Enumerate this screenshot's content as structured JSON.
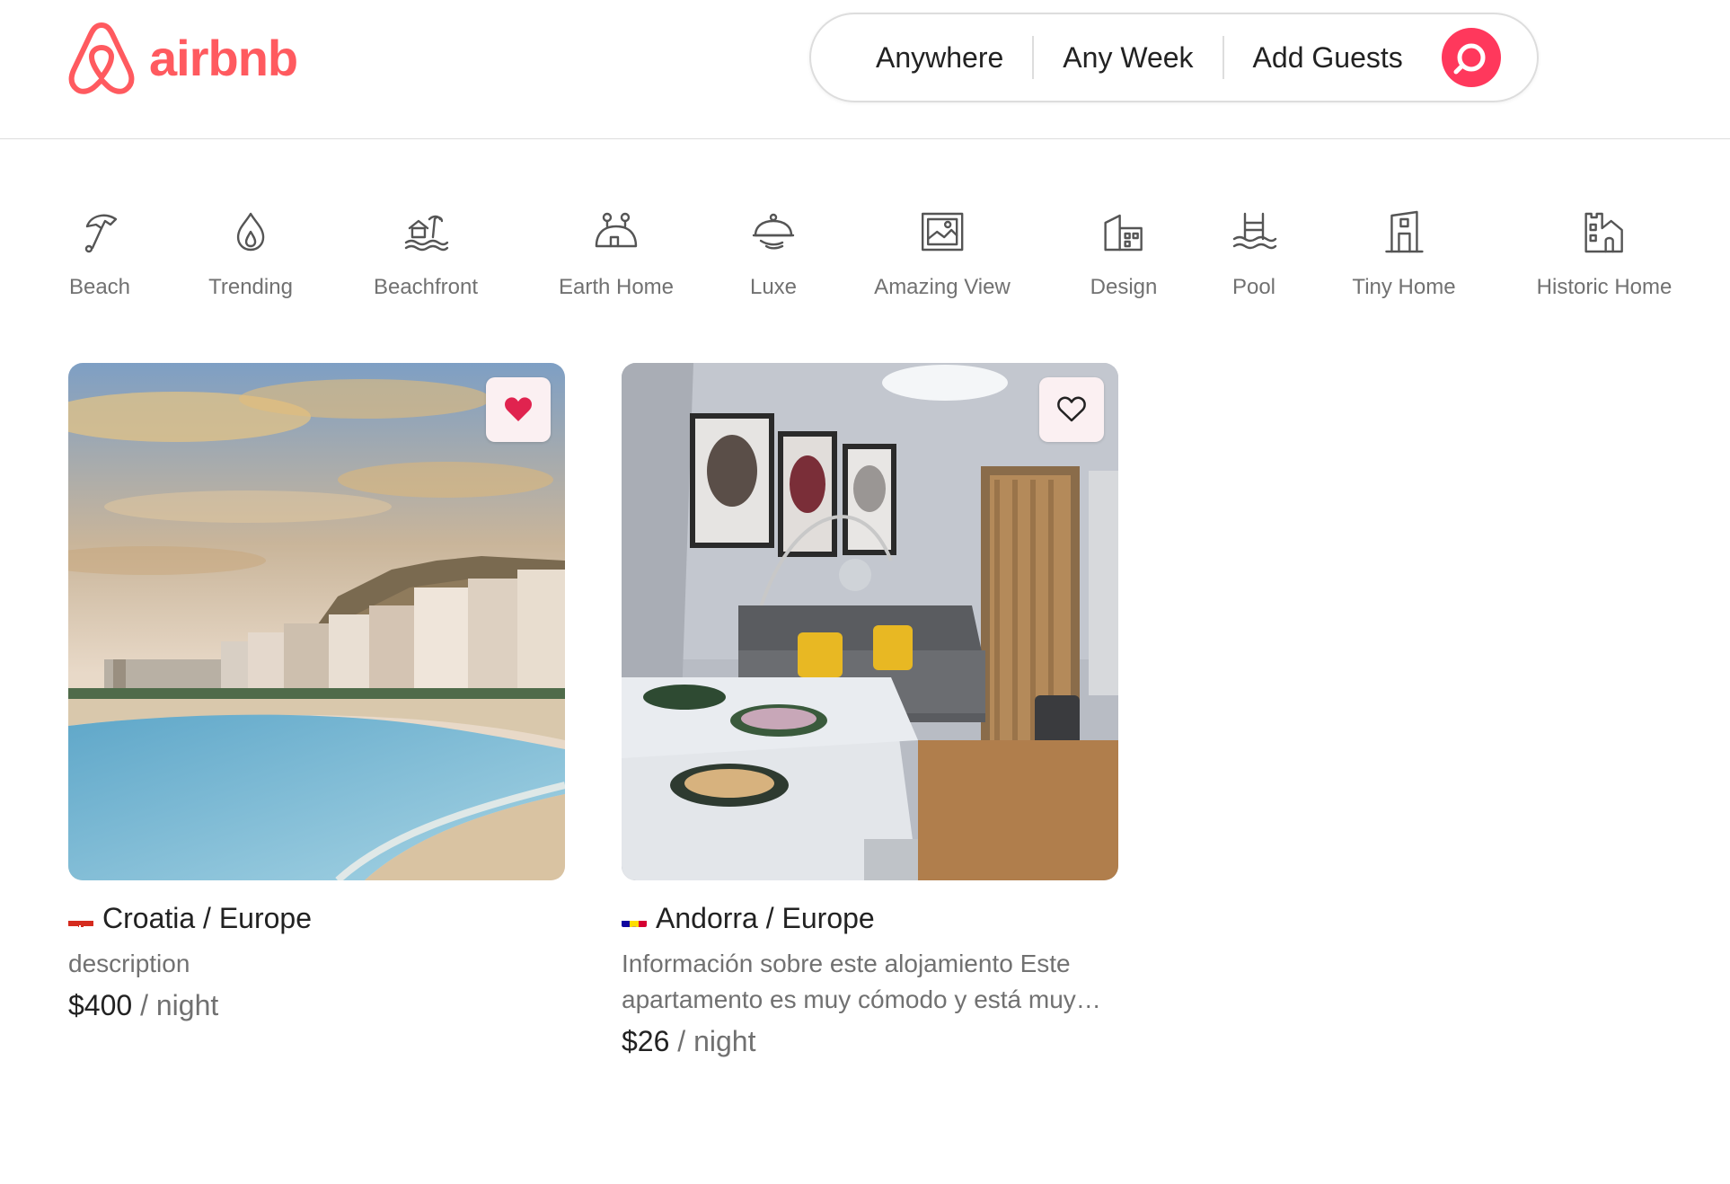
{
  "header": {
    "logo_text": "airbnb",
    "brand_color": "#ff5a5f",
    "search": {
      "where": "Anywhere",
      "when": "Any Week",
      "who": "Add Guests",
      "button_color": "#ff385c"
    }
  },
  "categories": [
    {
      "label": "Beach",
      "icon": "umbrella-icon"
    },
    {
      "label": "Trending",
      "icon": "flame-icon"
    },
    {
      "label": "Beachfront",
      "icon": "beachfront-icon"
    },
    {
      "label": "Earth Home",
      "icon": "earth-home-icon"
    },
    {
      "label": "Luxe",
      "icon": "cloche-icon"
    },
    {
      "label": "Amazing View",
      "icon": "view-icon"
    },
    {
      "label": "Design",
      "icon": "design-icon"
    },
    {
      "label": "Pool",
      "icon": "pool-icon"
    },
    {
      "label": "Tiny Home",
      "icon": "tiny-home-icon"
    },
    {
      "label": "Historic Home",
      "icon": "castle-icon"
    }
  ],
  "listings": [
    {
      "flag": "croatia-flag-icon",
      "location": "Croatia / Europe",
      "description": "description",
      "price": "$400",
      "price_unit": "/ night",
      "favorited": true
    },
    {
      "flag": "andorra-flag-icon",
      "location": "Andorra / Europe",
      "description": "Información sobre este alojamiento Este apartamento es muy cómodo y está muy…",
      "price": "$26",
      "price_unit": "/ night",
      "favorited": false
    }
  ]
}
